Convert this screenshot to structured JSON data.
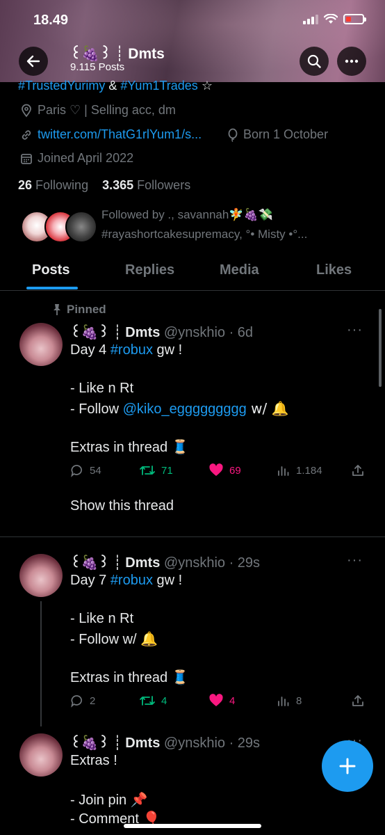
{
  "status_bar": {
    "time": "18.49"
  },
  "header": {
    "display_name": "꒰🍇꒱ ┊ Dmts",
    "posts_count": "9.115 Posts"
  },
  "profile": {
    "bio_line": {
      "tag1": "#TrustedYurimy",
      "amp": " & ",
      "tag2": "#Yum1Trades",
      "star": " ☆"
    },
    "location": "Paris ♡ | Selling acc, dm",
    "link": "twitter.com/ThatG1rlYum1/s...",
    "born": "Born 1 October",
    "joined": "Joined April 2022",
    "following_count": "26",
    "following_label": "Following",
    "followers_count": "3.365",
    "followers_label": "Followers",
    "followed_by_line1": "Followed by ., savannah🧚🍇💸",
    "followed_by_line2": "#rayashortcakesupremacy, °• Misty •°..."
  },
  "tabs": [
    {
      "label": "Posts"
    },
    {
      "label": "Replies"
    },
    {
      "label": "Media"
    },
    {
      "label": "Likes"
    }
  ],
  "posts": [
    {
      "pinned_label": "Pinned",
      "name": "꒰🍇꒱ ┊ Dmts",
      "handle_time": "@ynskhio · 6d",
      "lines": {
        "l1a": "Day 4 ",
        "l1tag": "#robux",
        "l1b": " gw !",
        "l2": "- Like n Rt",
        "l3a": "- Follow ",
        "l3mention": "@kiko_eggggggggg",
        "l3b": " w/ 🔔",
        "l4": "Extras in thread 🧵"
      },
      "replies": "54",
      "reposts": "71",
      "likes": "69",
      "views": "1.184",
      "show_thread": "Show this thread"
    },
    {
      "name": "꒰🍇꒱ ┊ Dmts",
      "handle_time": "@ynskhio · 29s",
      "lines": {
        "l1a": "Day 7 ",
        "l1tag": "#robux",
        "l1b": " gw !",
        "l2": "- Like n Rt",
        "l3": "- Follow w/ 🔔",
        "l4": "Extras in thread 🧵"
      },
      "replies": "2",
      "reposts": "4",
      "likes": "4",
      "views": "8"
    },
    {
      "name": "꒰🍇꒱ ┊ Dmts",
      "handle_time": "@ynskhio · 29s",
      "lines": {
        "l1": "Extras !",
        "l2": "- Join pin 📌",
        "l3": "- Comment 🎈"
      }
    }
  ],
  "colors": {
    "accent": "#1d9bf0",
    "like": "#f91880",
    "repost": "#00ba7c",
    "muted": "#71767b"
  }
}
